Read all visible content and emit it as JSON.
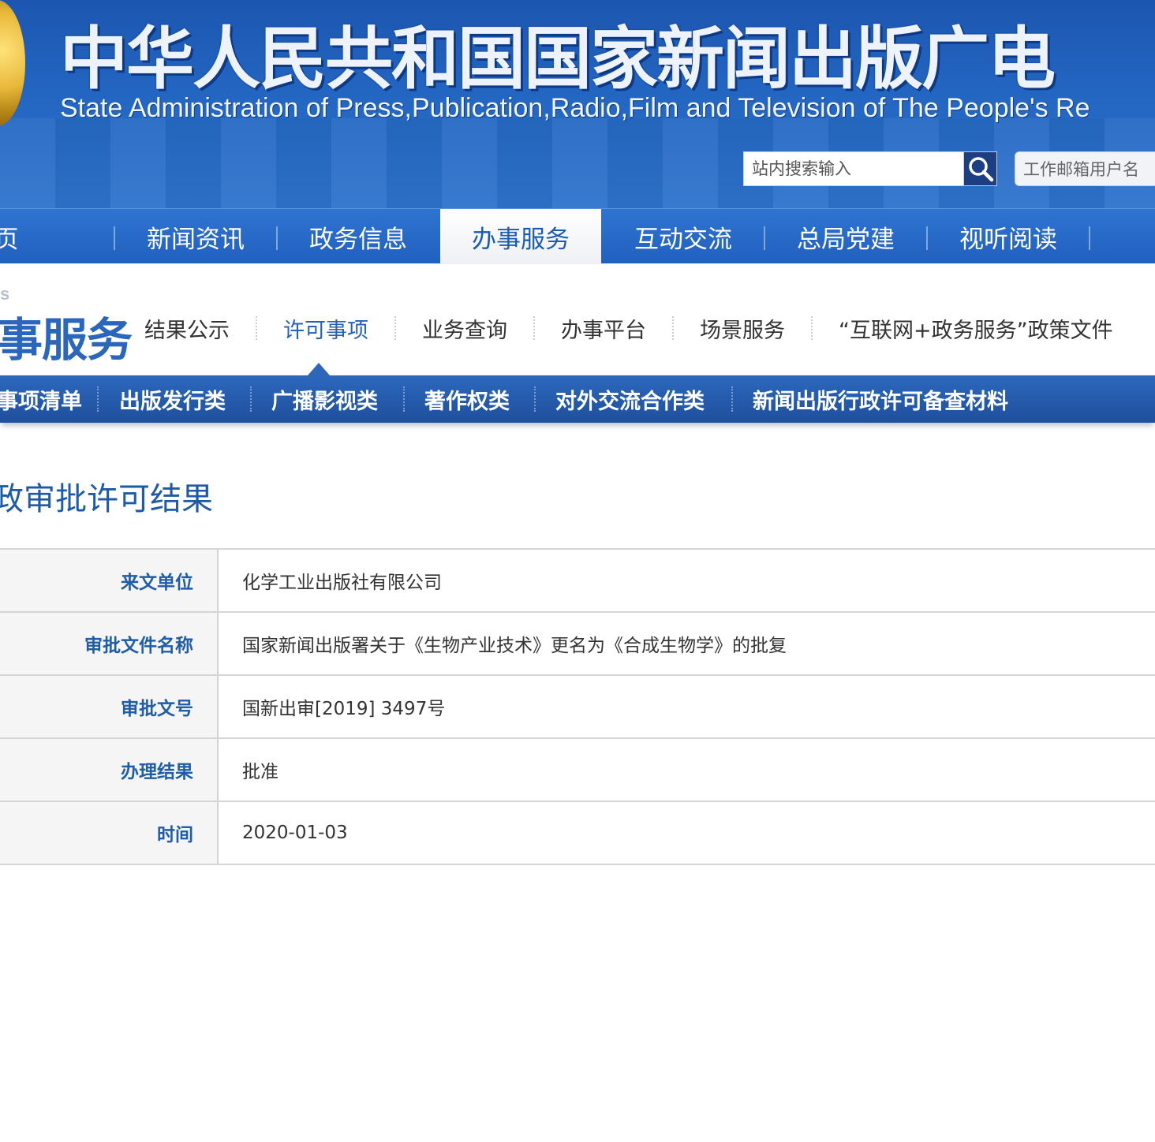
{
  "header": {
    "title": "中华人民共和国国家新闻出版广电",
    "subtitle": "State Administration of Press,Publication,Radio,Film and Television of The People's Re",
    "search_placeholder": "站内搜索输入",
    "mail_placeholder": "工作邮箱用户名"
  },
  "main_nav": {
    "items": [
      "页",
      "新闻资讯",
      "政务信息",
      "办事服务",
      "互动交流",
      "总局党建",
      "视听阅读"
    ],
    "active": "办事服务"
  },
  "section": {
    "mark": "s",
    "title": "事服务",
    "sub_nav": [
      "结果公示",
      "许可事项",
      "业务查询",
      "办事平台",
      "场景服务",
      "“互联网+政务服务”政策文件"
    ],
    "active_sub": "许可事项"
  },
  "category_bar": {
    "items": [
      "事项清单",
      "出版发行类",
      "广播影视类",
      "著作权类",
      "对外交流合作类",
      "新闻出版行政许可备查材料"
    ]
  },
  "page": {
    "heading": "政审批许可结果"
  },
  "record": [
    {
      "label": "来文单位",
      "value": "化学工业出版社有限公司"
    },
    {
      "label": "审批文件名称",
      "value": "国家新闻出版署关于《生物产业技术》更名为《合成生物学》的批复"
    },
    {
      "label": "审批文号",
      "value": "国新出审[2019] 3497号"
    },
    {
      "label": "办理结果",
      "value": "批准"
    },
    {
      "label": "时间",
      "value": "2020-01-03"
    }
  ],
  "icons": {
    "search": "magnifier-icon",
    "emblem": "national-emblem-icon"
  }
}
